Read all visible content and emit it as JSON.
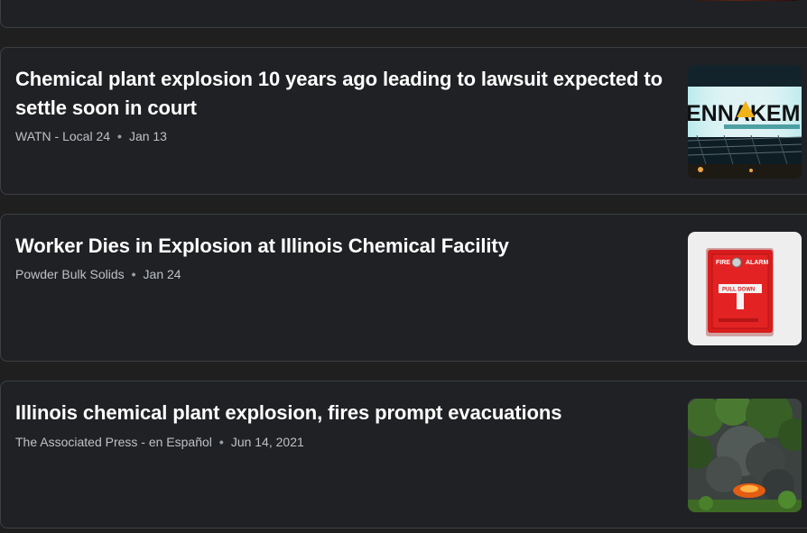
{
  "articles": [
    {
      "headline": "Chemical plant explosion 10 years ago leading to lawsuit expected to settle soon in court",
      "source": "WATN - Local 24",
      "date": "Jan 13",
      "thumbnail_icon": "factory-sign-image",
      "thumbnail_text": "ENNAKEM"
    },
    {
      "headline": "Worker Dies in Explosion at Illinois Chemical Facility",
      "source": "Powder Bulk Solids",
      "date": "Jan 24",
      "thumbnail_icon": "fire-alarm-image",
      "thumbnail_text_top_left": "FIRE",
      "thumbnail_text_top_right": "ALARM",
      "thumbnail_text_mid": "PULL DOWN"
    },
    {
      "headline": "Illinois chemical plant explosion, fires prompt evacuations",
      "source": "The Associated Press - en Español",
      "date": "Jun 14, 2021",
      "thumbnail_icon": "smoke-fire-image"
    }
  ],
  "separator": "•",
  "colors": {
    "card_bg": "#202124",
    "card_border": "#3c4043",
    "headline": "#ffffff",
    "meta": "#bdc1c6"
  }
}
